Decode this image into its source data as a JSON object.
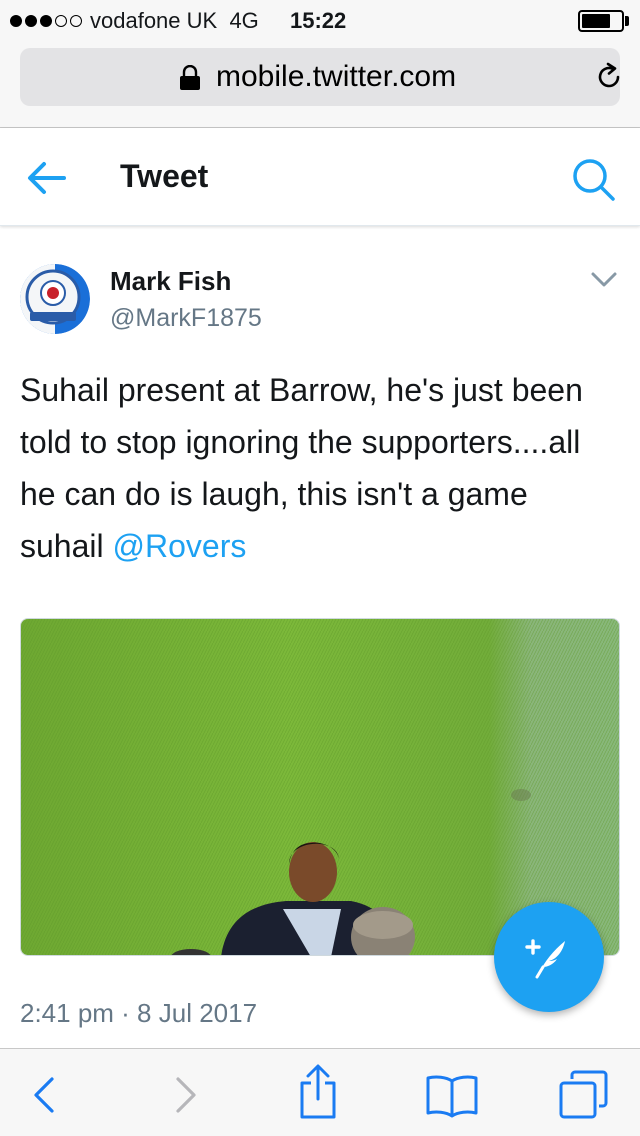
{
  "status_bar": {
    "carrier": "vodafone UK",
    "network": "4G",
    "time": "15:22",
    "signal_strength": 3,
    "battery_level": 0.66
  },
  "browser": {
    "url": "mobile.twitter.com",
    "icons": [
      "lock-icon",
      "reload-icon"
    ]
  },
  "header": {
    "title": "Tweet",
    "icons": [
      "back-arrow-icon",
      "search-icon"
    ]
  },
  "tweet": {
    "display_name": "Mark Fish",
    "handle": "@MarkF1875",
    "text": "Suhail present at Barrow, he's just been told to stop ignoring the supporters....all he can do is laugh, this isn't a game suhail ",
    "mention": "@Rovers",
    "timestamp": "2:41 pm · 8 Jul 2017",
    "icons": [
      "avatar",
      "chevron-down-icon",
      "tweet-photo"
    ]
  },
  "fab": {
    "icon": "compose-tweet-icon"
  },
  "toolbar": {
    "icons": [
      "back-icon",
      "forward-icon",
      "share-icon",
      "bookmarks-icon",
      "tabs-icon"
    ]
  },
  "colors": {
    "accent": "#1da1f2",
    "text": "#14171a",
    "muted": "#657786",
    "ios_blue": "#1a7bf2",
    "bar_bg": "#f7f7f7"
  }
}
